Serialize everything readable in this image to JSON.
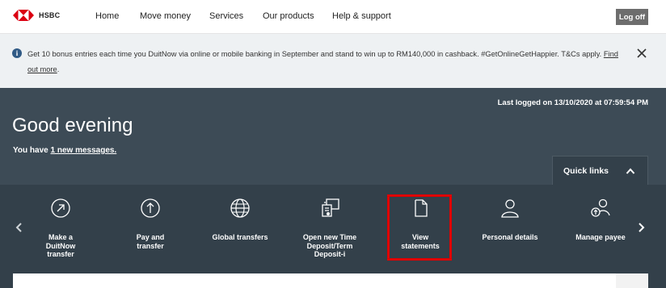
{
  "brand": {
    "name": "HSBC",
    "colors": {
      "red": "#db0011",
      "hero": "#3d4b56",
      "bar": "#33404a"
    }
  },
  "nav": {
    "items": [
      "Home",
      "Move money",
      "Services",
      "Our products",
      "Help & support"
    ],
    "logoff_label": "Log off"
  },
  "banner": {
    "text": "Get 10 bonus entries each time you DuitNow via online or mobile banking in September and stand to win up to RM140,000 in cashback. #GetOnlineGetHappier. T&Cs apply.",
    "link": "Find out more",
    "link_suffix": "."
  },
  "hero": {
    "last_logged": "Last logged on 13/10/2020 at 07:59:54 PM",
    "greeting": "Good evening",
    "messages_prefix": "You have ",
    "messages_link": "1 new messages."
  },
  "quick_links": {
    "label": "Quick links",
    "items": [
      {
        "label": "Make a DuitNow transfer",
        "icon": "arrow-up-right-circle-icon"
      },
      {
        "label": "Pay and transfer",
        "icon": "arrow-up-circle-icon"
      },
      {
        "label": "Global transfers",
        "icon": "globe-icon"
      },
      {
        "label": "Open new Time Deposit/Term Deposit-i",
        "icon": "deposit-icon"
      },
      {
        "label": "View statements",
        "icon": "document-icon"
      },
      {
        "label": "Personal details",
        "icon": "person-icon"
      },
      {
        "label": "Manage payee",
        "icon": "person-transfer-icon"
      }
    ]
  }
}
